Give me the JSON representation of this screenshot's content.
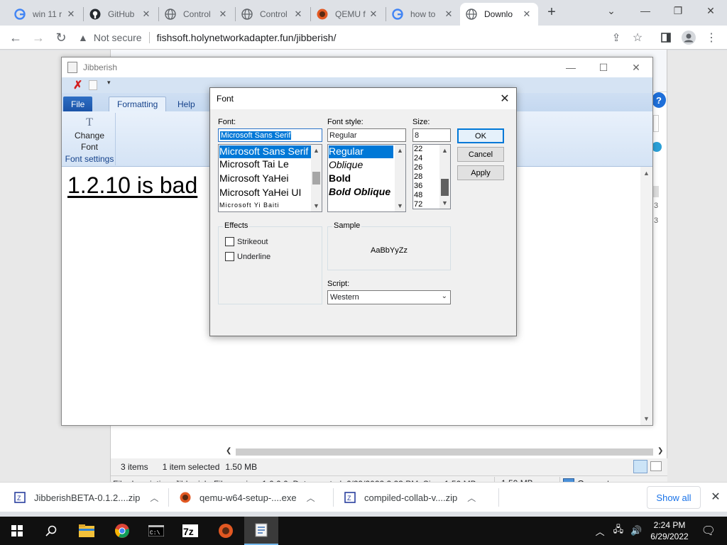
{
  "browser": {
    "tabs": [
      {
        "title": "win 11 r",
        "favicon": "google-icon",
        "active": false
      },
      {
        "title": "GitHub",
        "favicon": "github-icon",
        "active": false
      },
      {
        "title": "Control",
        "favicon": "globe-icon",
        "active": false
      },
      {
        "title": "Control",
        "favicon": "globe-icon",
        "active": false
      },
      {
        "title": "QEMU f",
        "favicon": "qemu-icon",
        "active": false
      },
      {
        "title": "how to",
        "favicon": "google-icon",
        "active": false
      },
      {
        "title": "Downlo",
        "favicon": "globe-icon",
        "active": true
      }
    ],
    "new_tab": "+",
    "security_label": "Not secure",
    "url": "fishsoft.holynetworkadapter.fun/jibberish/"
  },
  "explorer": {
    "items_count": "3 items",
    "selection": "1 item selected",
    "selection_size": "1.50 MB",
    "file_description": "File description: Jibberish, File version: 1.0.0.0, Date created: 6/29/2022 2:23 PM, Size: 1.50 MB",
    "status_size": "1.50 MB",
    "location": "Computer"
  },
  "jibberish": {
    "title": "Jibberish",
    "ribbon_tabs": {
      "file": "File",
      "formatting": "Formatting",
      "help": "Help"
    },
    "change_font_label": "Change Font",
    "group_label": "Font settings",
    "document_text": "1.2.10 is bad"
  },
  "font_dialog": {
    "title": "Font",
    "font_label": "Font:",
    "font_value": "Microsoft Sans Serif",
    "fonts": [
      "Microsoft Sans Serif",
      "Microsoft Tai Le",
      "Microsoft YaHei",
      "Microsoft YaHei UI",
      "Microsoft Yi Baiti"
    ],
    "style_label": "Font style:",
    "style_value": "Regular",
    "styles": [
      "Regular",
      "Oblique",
      "Bold",
      "Bold Oblique"
    ],
    "size_label": "Size:",
    "size_value": "8",
    "sizes": [
      "22",
      "24",
      "26",
      "28",
      "36",
      "48",
      "72"
    ],
    "ok": "OK",
    "cancel": "Cancel",
    "apply": "Apply",
    "effects_label": "Effects",
    "strikeout": "Strikeout",
    "underline": "Underline",
    "sample_label": "Sample",
    "sample_text": "AaBbYyZz",
    "script_label": "Script:",
    "script_value": "Western"
  },
  "downloads": {
    "items": [
      "JibberishBETA-0.1.2....zip",
      "qemu-w64-setup-....exe",
      "compiled-collab-v....zip"
    ],
    "show_all": "Show all"
  },
  "taskbar": {
    "time": "2:24 PM",
    "date": "6/29/2022"
  },
  "colors": {
    "accent": "#0078d7",
    "ribbon_file": "#1b54a8",
    "chrome_frame": "#dee1e6",
    "link_blue": "#1a73e8"
  }
}
